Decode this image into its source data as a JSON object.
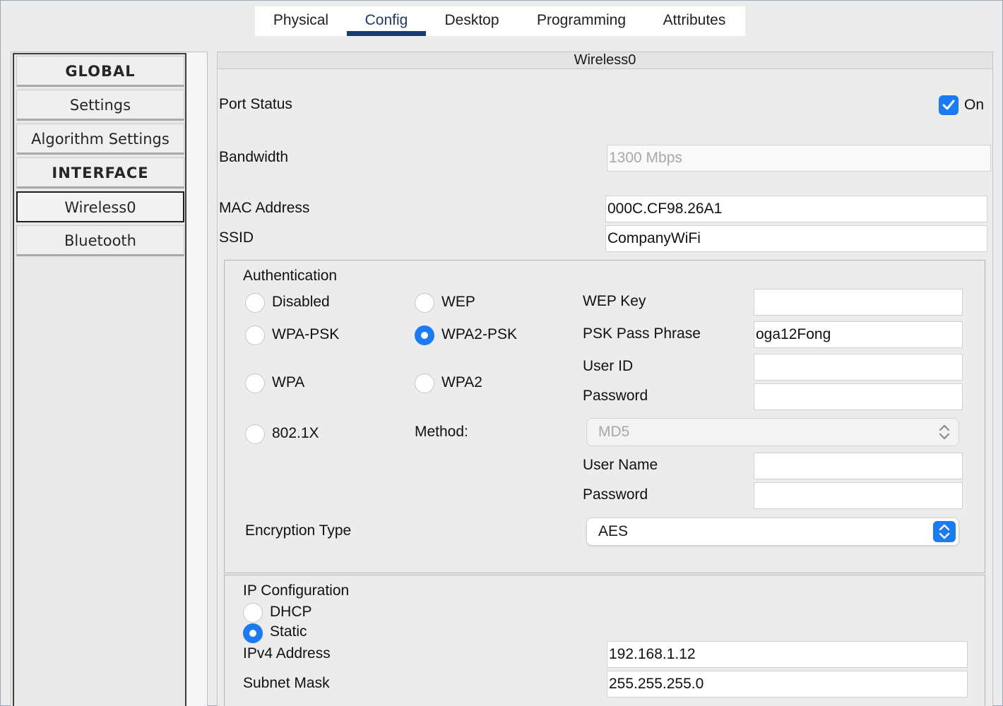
{
  "tabs": [
    {
      "label": "Physical"
    },
    {
      "label": "Config"
    },
    {
      "label": "Desktop"
    },
    {
      "label": "Programming"
    },
    {
      "label": "Attributes"
    }
  ],
  "active_tab": "Config",
  "sidebar": {
    "items": [
      {
        "label": "GLOBAL",
        "type": "heading"
      },
      {
        "label": "Settings",
        "type": "item"
      },
      {
        "label": "Algorithm Settings",
        "type": "item"
      },
      {
        "label": "INTERFACE",
        "type": "heading"
      },
      {
        "label": "Wireless0",
        "type": "item",
        "selected": true
      },
      {
        "label": "Bluetooth",
        "type": "item"
      }
    ]
  },
  "panel": {
    "title": "Wireless0",
    "port_status": {
      "label": "Port Status",
      "checkbox_label": "On",
      "checked": true
    },
    "bandwidth": {
      "label": "Bandwidth",
      "value": "1300 Mbps"
    },
    "mac": {
      "label": "MAC Address",
      "value": "000C.CF98.26A1"
    },
    "ssid": {
      "label": "SSID",
      "value": "CompanyWiFi"
    }
  },
  "auth": {
    "title": "Authentication",
    "options": {
      "disabled": "Disabled",
      "wep": "WEP",
      "wpa_psk": "WPA-PSK",
      "wpa2_psk": "WPA2-PSK",
      "wpa": "WPA",
      "wpa2": "WPA2",
      "dot1x": "802.1X"
    },
    "selected": "WPA2-PSK",
    "wep_key_label": "WEP Key",
    "wep_key_value": "",
    "psk_label": "PSK Pass Phrase",
    "psk_value": "oga12Fong",
    "user_id_label": "User ID",
    "password_label": "Password",
    "method_label": "Method:",
    "method_value": "MD5",
    "user_name_label": "User Name",
    "password2_label": "Password",
    "encryption_label": "Encryption Type",
    "encryption_value": "AES"
  },
  "ipconfig": {
    "title": "IP Configuration",
    "dhcp_label": "DHCP",
    "static_label": "Static",
    "selected": "Static",
    "ipv4_label": "IPv4 Address",
    "ipv4_value": "192.168.1.12",
    "mask_label": "Subnet Mask",
    "mask_value": "255.255.255.0"
  },
  "colors": {
    "accent": "#1a7cf5",
    "tab_active": "#1b3b6f"
  }
}
